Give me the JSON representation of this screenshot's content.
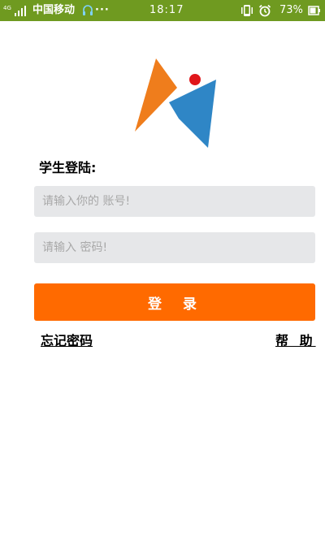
{
  "status_bar": {
    "network_label": "4G",
    "carrier": "中国移动",
    "more_indicator": "···",
    "time": "18:17",
    "battery_percent": "73%",
    "icons": [
      "signal-icon",
      "headset-icon",
      "vibrate-icon",
      "alarm-icon",
      "battery-icon"
    ]
  },
  "logo": {
    "colors": {
      "orange": "#ef7d1c",
      "blue": "#2f86c6",
      "red": "#e0161a"
    }
  },
  "login": {
    "title": "学生登陆:",
    "account_placeholder": "请输入你的 账号!",
    "password_placeholder": "请输入 密码!",
    "button_label": "登 录",
    "forgot_link": "忘记密码",
    "help_link": "帮 助"
  },
  "colors": {
    "status_bar_bg": "#6f9a20",
    "button_bg": "#ff6a00",
    "field_bg": "#e6e7e9"
  }
}
